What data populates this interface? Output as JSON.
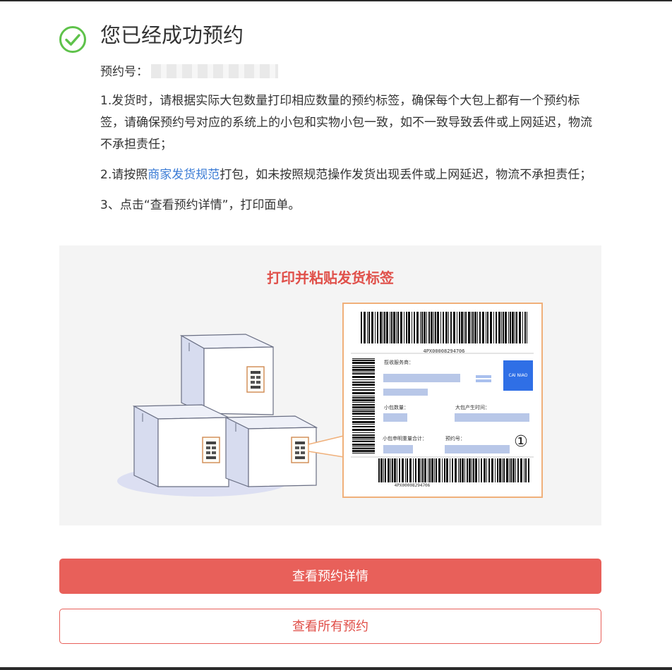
{
  "header": {
    "title": "您已经成功预约",
    "icon": "check-circle-icon",
    "accent_color": "#5ec24a"
  },
  "order": {
    "label": "预约号："
  },
  "notes": {
    "item1": "1.发货时，请根据实际大包数量打印相应数量的预约标签，确保每个大包上都有一个预约标签，请确保预约号对应的系统上的小包和实物小包一致，如不一致导致丢件或上网延迟，物流不承担责任；",
    "item2_prefix": "2.请按照",
    "item2_link": "商家发货规范",
    "item2_suffix": "打包，如未按照规范操作发货出现丢件或上网延迟，物流不承担责任；",
    "item3": "3、点击“查看预约详情”，打印面单。"
  },
  "illustration": {
    "title": "打印并粘贴发货标签",
    "label": {
      "barcode_top_text": "4PX00008294706",
      "barcode_bottom_text": "4PX00008294706",
      "field_service": "揽收服务商：",
      "field_small_count": "小包数量：",
      "field_created_time": "大包产生时间：",
      "field_declared_weight": "小包申明重量合计：",
      "field_booking_no": "预约号：",
      "marker": "①",
      "logo_text": "CAI NIAO"
    }
  },
  "actions": {
    "view_detail": "查看预约详情",
    "view_all": "查看所有预约",
    "primary_color": "#e8605a"
  }
}
